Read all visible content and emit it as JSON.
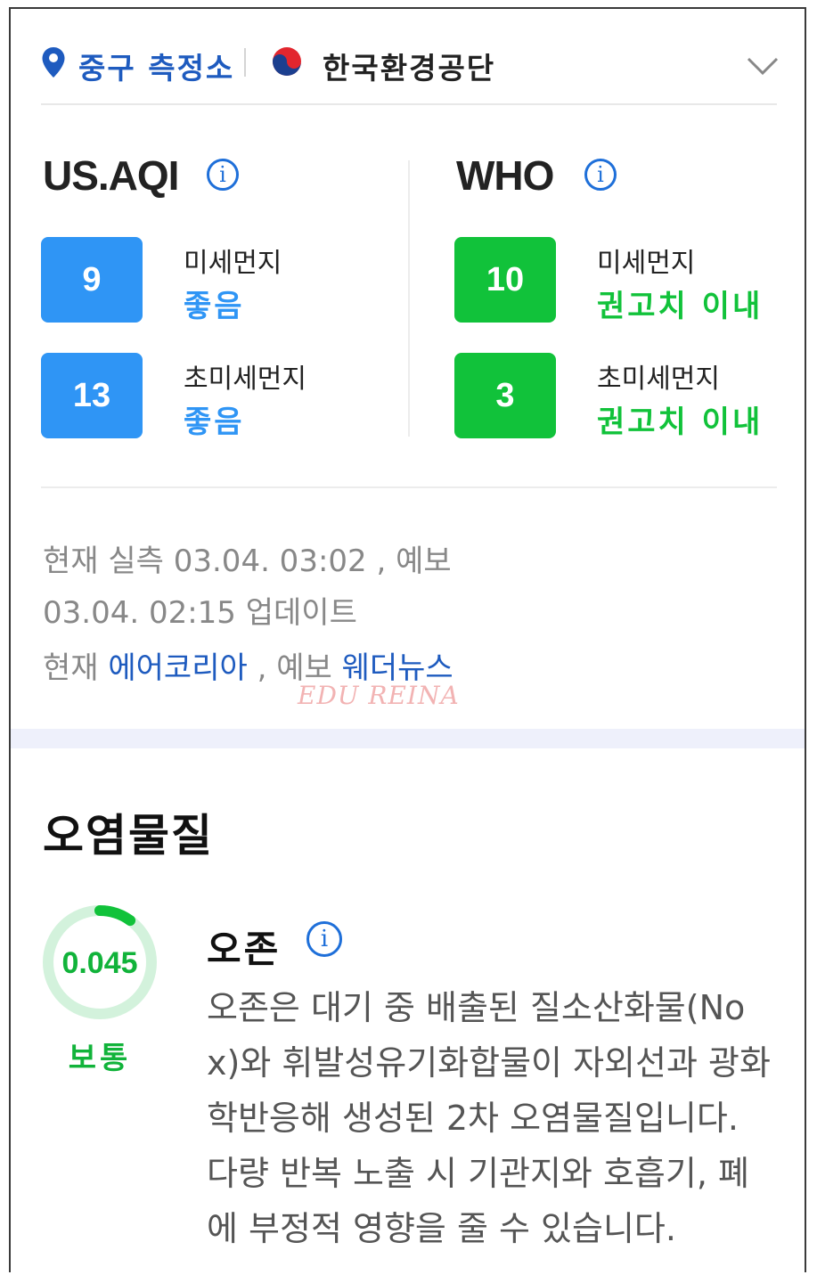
{
  "header": {
    "station": "중구 측정소",
    "agency": "한국환경공단"
  },
  "us_aqi": {
    "title": "US.AQI",
    "info": "i",
    "items": [
      {
        "name": "미세먼지",
        "value": "9",
        "grade": "좋음"
      },
      {
        "name": "초미세먼지",
        "value": "13",
        "grade": "좋음"
      }
    ],
    "color": "#2f95f5"
  },
  "who": {
    "title": "WHO",
    "info": "i",
    "items": [
      {
        "name": "미세먼지",
        "value": "10",
        "grade": "권고치 이내"
      },
      {
        "name": "초미세먼지",
        "value": "3",
        "grade": "권고치 이내"
      }
    ],
    "color": "#11c23a"
  },
  "meta": {
    "line1": "현재 실측  03.04. 03:02 , 예보",
    "line2": "03.04. 02:15 업데이트",
    "source_prefix": "현재 ",
    "source_current": "에어코리아",
    "source_mid": " , 예보 ",
    "source_forecast": "웨더뉴스"
  },
  "watermark": "EDU REINA",
  "pollutants": {
    "title": "오염물질",
    "ozone": {
      "value": "0.045",
      "grade": "보통",
      "name": "오존",
      "info": "i",
      "level_fraction": 0.1,
      "description": "오존은 대기 중 배출된 질소산화물(Nox)와 휘발성유기화합물이 자외선과 광화학반응해 생성된 2차 오염물질입니다. 다량 반복 노출 시 기관지와 호흡기, 폐에 부정적 영향을 줄 수 있습니다."
    }
  },
  "icons": [
    "location-pin-icon",
    "government-emblem-icon",
    "chevron-down-icon",
    "info-icon"
  ]
}
